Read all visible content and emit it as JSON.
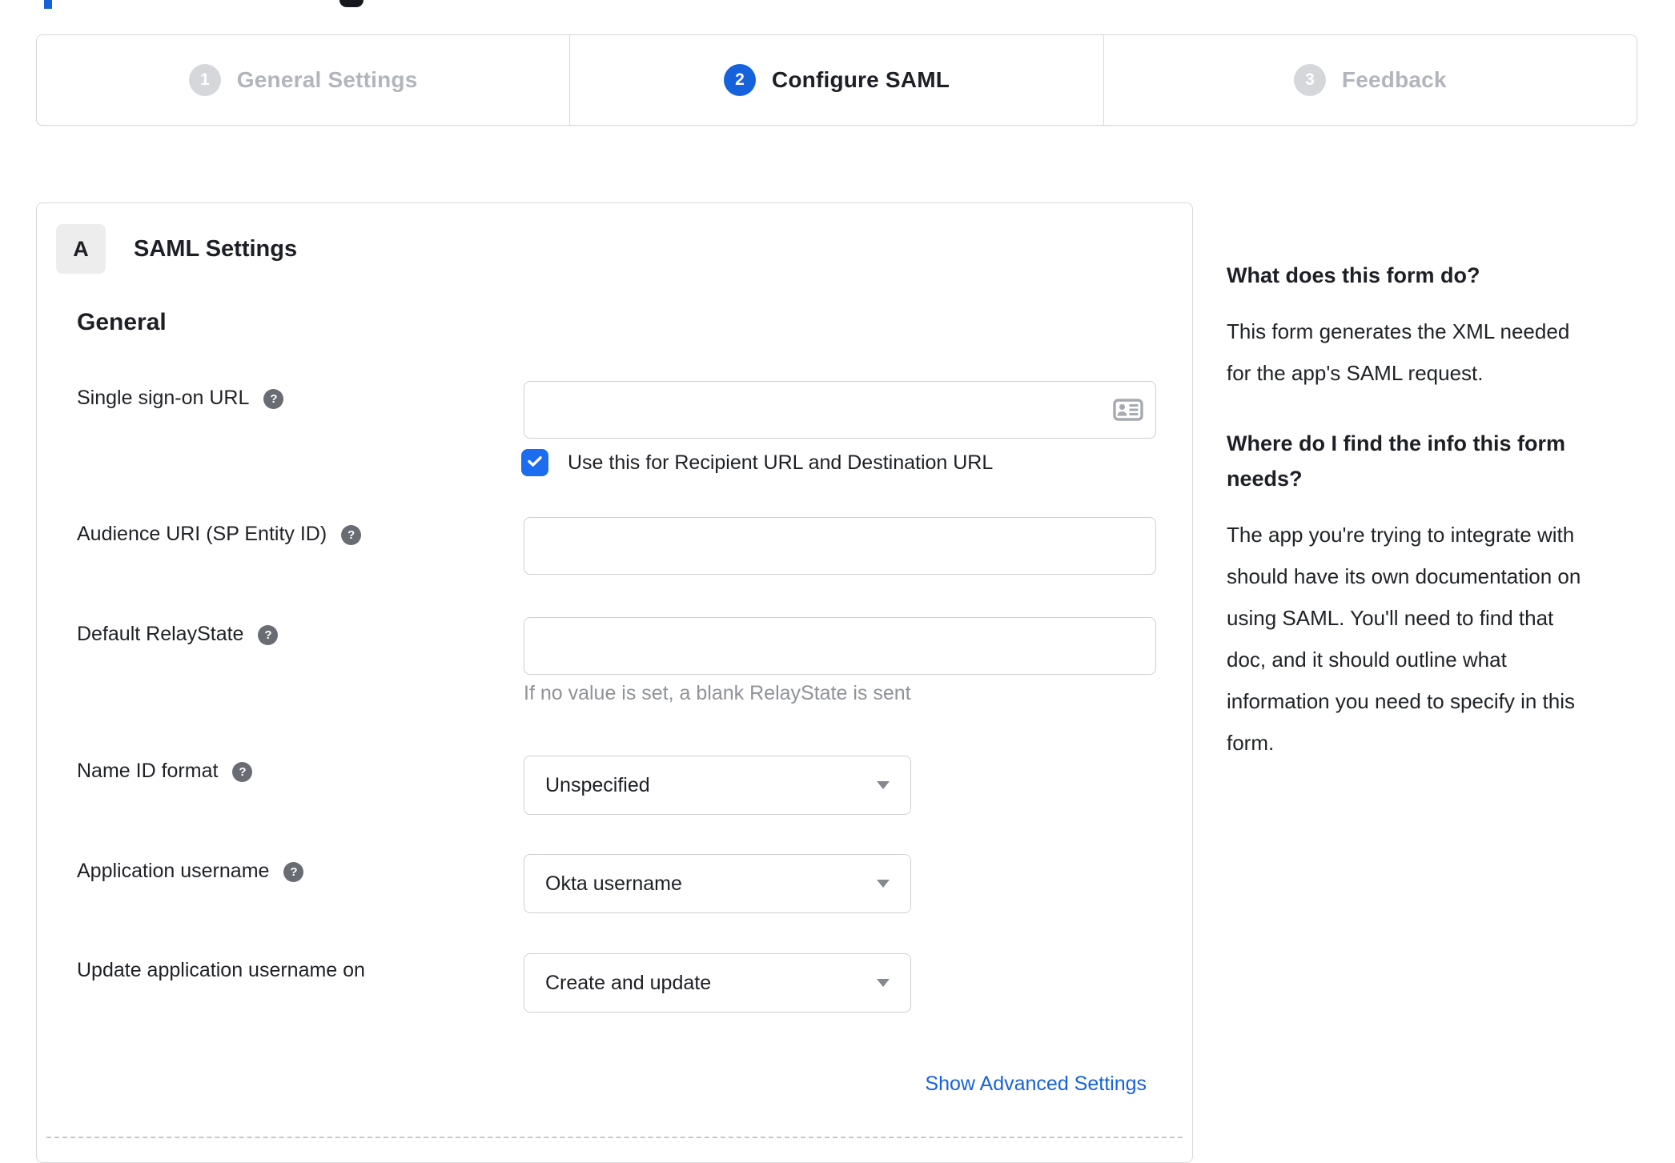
{
  "stepper": {
    "steps": [
      {
        "number": "1",
        "label": "General Settings",
        "state": "inactive"
      },
      {
        "number": "2",
        "label": "Configure SAML",
        "state": "active"
      },
      {
        "number": "3",
        "label": "Feedback",
        "state": "inactive"
      }
    ]
  },
  "form": {
    "section_badge": "A",
    "section_title": "SAML Settings",
    "group_heading": "General",
    "fields": {
      "sso_url": {
        "label": "Single sign-on URL",
        "value": "",
        "checkbox_label": "Use this for Recipient URL and Destination URL",
        "checkbox_checked": true
      },
      "audience_uri": {
        "label": "Audience URI (SP Entity ID)",
        "value": ""
      },
      "default_relaystate": {
        "label": "Default RelayState",
        "value": "",
        "helper": "If no value is set, a blank RelayState is sent"
      },
      "name_id_format": {
        "label": "Name ID format",
        "value": "Unspecified"
      },
      "application_username": {
        "label": "Application username",
        "value": "Okta username"
      },
      "update_application_username_on": {
        "label": "Update application username on",
        "value": "Create and update"
      }
    },
    "help_icon_glyph": "?",
    "advanced_link": "Show Advanced Settings"
  },
  "help_panel": {
    "q1_title": "What does this form do?",
    "q1_body": "This form generates the XML needed\nfor the app's SAML request.",
    "q2_title": "Where do I find the info this form\nneeds?",
    "q2_body": "The app you're trying to integrate with\nshould have its own documentation on\nusing SAML. You'll need to find that\ndoc, and it should outline what\ninformation you need to specify in this\nform."
  },
  "colors": {
    "accent_blue": "#1662dd",
    "checkbox_blue": "#1c6cf0",
    "inactive_gray": "#d5d7db",
    "inactive_text": "#b2b5bb",
    "border_gray": "#d8d8dc",
    "helper_gray": "#8f9297",
    "text_dark": "#1d1f24"
  }
}
